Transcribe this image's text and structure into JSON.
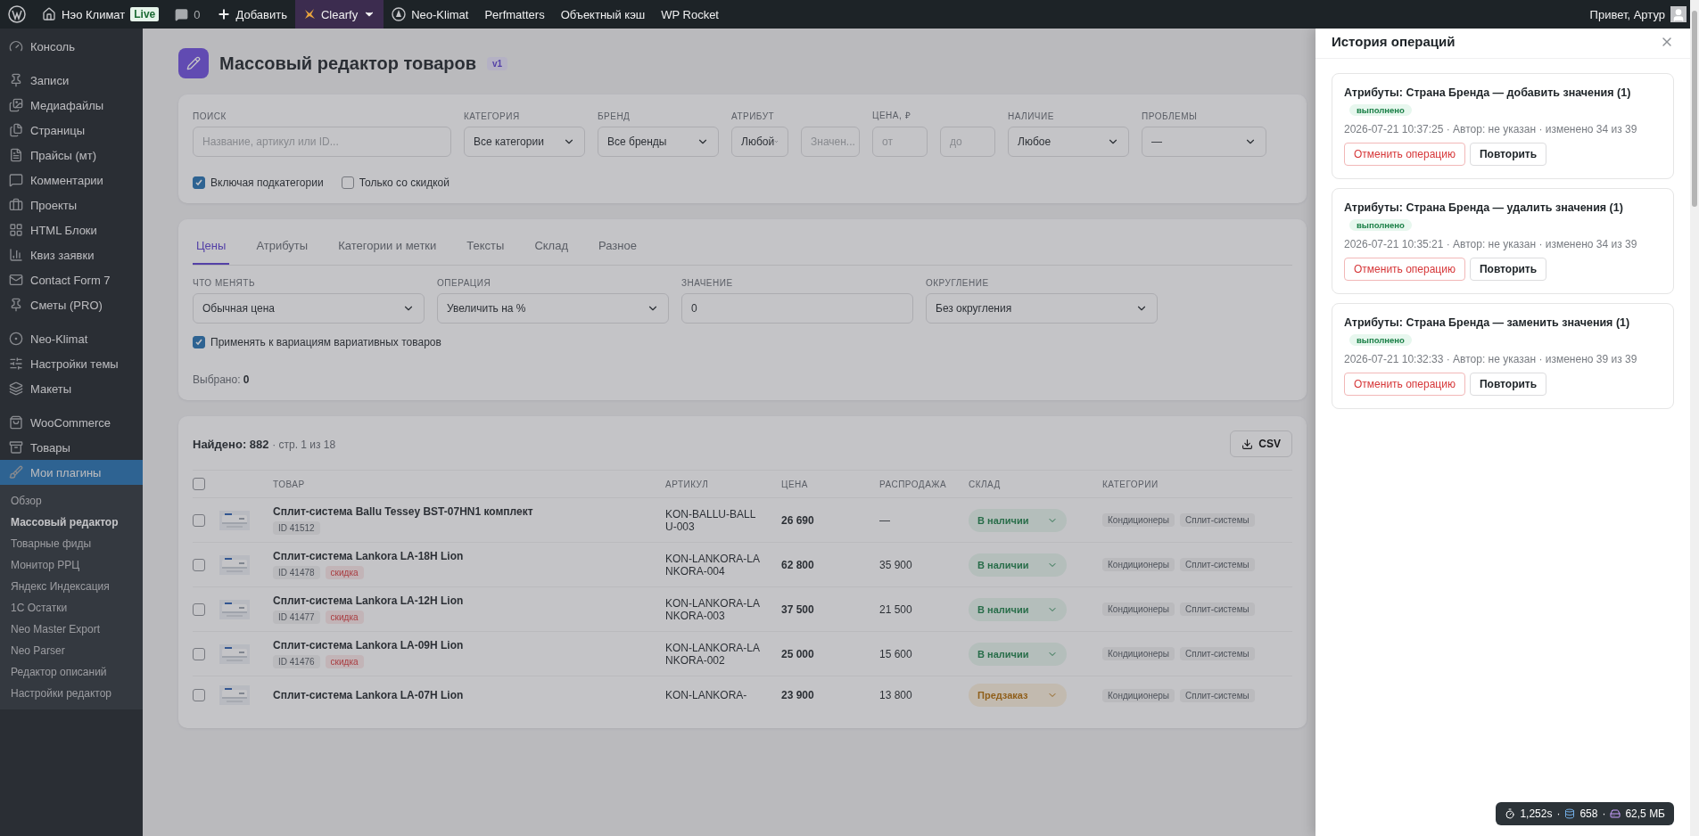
{
  "admin_bar": {
    "items": [
      {
        "kind": "logo",
        "highlighted": false
      },
      {
        "kind": "home",
        "label": "Нэо Климат",
        "badge": "Live",
        "highlighted": false
      },
      {
        "kind": "comments",
        "label": "0",
        "highlighted": false
      },
      {
        "kind": "add",
        "label": "Добавить",
        "highlighted": false
      },
      {
        "kind": "clearfy",
        "label": "Clearfy",
        "highlighted": true
      },
      {
        "kind": "neo",
        "label": "Neo-Klimat",
        "highlighted": false
      },
      {
        "kind": "text",
        "label": "Perfmatters",
        "highlighted": false
      },
      {
        "kind": "text",
        "label": "Объектный кэш",
        "highlighted": false
      },
      {
        "kind": "text",
        "label": "WP Rocket",
        "highlighted": false
      }
    ],
    "greeting": "Привет, Артур"
  },
  "sidebar": {
    "groups": [
      [
        {
          "label": "Консоль",
          "current": false
        }
      ],
      [
        {
          "label": "Записи",
          "current": false
        },
        {
          "label": "Медиафайлы",
          "current": false
        },
        {
          "label": "Страницы",
          "current": false
        },
        {
          "label": "Прайсы (мт)",
          "current": false
        },
        {
          "label": "Комментарии",
          "current": false
        },
        {
          "label": "Проекты",
          "current": false
        },
        {
          "label": "HTML Блоки",
          "current": false
        },
        {
          "label": "Квиз заявки",
          "current": false
        },
        {
          "label": "Contact Form 7",
          "current": false
        },
        {
          "label": "Сметы (PRO)",
          "current": false
        }
      ],
      [
        {
          "label": "Neo-Klimat",
          "current": false
        },
        {
          "label": "Настройки темы",
          "current": false
        },
        {
          "label": "Макеты",
          "current": false
        }
      ],
      [
        {
          "label": "WooCommerce",
          "current": false
        },
        {
          "label": "Товары",
          "current": false
        },
        {
          "label": "Мои плагины",
          "current": true
        }
      ]
    ],
    "submenu": [
      {
        "label": "Обзор",
        "selected": false
      },
      {
        "label": "Массовый редактор",
        "selected": true
      },
      {
        "label": "Товарные фиды",
        "selected": false
      },
      {
        "label": "Монитор РРЦ",
        "selected": false
      },
      {
        "label": "Яндекс Индексация",
        "selected": false
      },
      {
        "label": "1С Остатки",
        "selected": false
      },
      {
        "label": "Neo Master Export",
        "selected": false
      },
      {
        "label": "Neo Parser",
        "selected": false
      },
      {
        "label": "Редактор описаний",
        "selected": false
      },
      {
        "label": "Настройки редактор",
        "selected": false
      }
    ]
  },
  "page": {
    "title": "Массовый редактор товаров",
    "version": "v1",
    "filters": [
      {
        "kind": "input",
        "label": "ПОИСК",
        "placeholder": "Название, артикул или ID..."
      },
      {
        "kind": "select",
        "label": "КАТЕГОРИЯ",
        "value": "Все категории"
      },
      {
        "kind": "select",
        "label": "БРЕНД",
        "value": "Все бренды"
      },
      {
        "kind": "pair",
        "label": "АТРИБУТ",
        "first": "Любой",
        "second": "Значен..."
      },
      {
        "kind": "range",
        "label": "ЦЕНА, ₽",
        "from": "от",
        "to": "до"
      },
      {
        "kind": "select",
        "label": "НАЛИЧИЕ",
        "value": "Любое"
      },
      {
        "kind": "select",
        "label": "ПРОБЛЕМЫ",
        "value": "—"
      }
    ],
    "options": [
      {
        "label": "Включая подкатегории",
        "checked": true
      },
      {
        "label": "Только со скидкой",
        "checked": false
      }
    ],
    "tabs": [
      {
        "label": "Цены",
        "selected": true
      },
      {
        "label": "Атрибуты",
        "selected": false
      },
      {
        "label": "Категории и метки",
        "selected": false
      },
      {
        "label": "Тексты",
        "selected": false
      },
      {
        "label": "Склад",
        "selected": false
      },
      {
        "label": "Разное",
        "selected": false
      }
    ],
    "edit_fields": [
      {
        "kind": "select",
        "label": "ЧТО МЕНЯТЬ",
        "value": "Обычная цена"
      },
      {
        "kind": "select",
        "label": "ОПЕРАЦИЯ",
        "value": "Увеличить на %"
      },
      {
        "kind": "input",
        "label": "ЗНАЧЕНИЕ",
        "value": "0"
      },
      {
        "kind": "select",
        "label": "ОКРУГЛЕНИЕ",
        "value": "Без округления"
      }
    ],
    "variations": {
      "label": "Применять к вариациям вариативных товаров",
      "checked": true
    },
    "selected_label": "Выбрано:",
    "selected_count": "0",
    "found_label": "Найдено: 882",
    "pages": "· стр. 1 из 18",
    "export": "CSV",
    "table": {
      "select_all_checked": false,
      "columns": [
        "ТОВАР",
        "АРТИКУЛ",
        "ЦЕНА",
        "РАСПРОДАЖА",
        "СКЛАД",
        "КАТЕГОРИИ"
      ],
      "rows": [
        {
          "checked": false,
          "name": "Сплит-система Ballu Tessey BST-07HN1 комплект",
          "id": "ID 41512",
          "tag": "",
          "sku": "KON-BALLU-BALLU-003",
          "price": "26 690",
          "sale": "—",
          "stock": {
            "label": "В наличии",
            "kind": "in"
          },
          "categories": [
            "Кондиционеры",
            "Сплит-системы"
          ]
        },
        {
          "checked": false,
          "name": "Сплит-система Lankora LA-18H Lion",
          "id": "ID 41478",
          "tag": "скидка",
          "sku": "KON-LANKORA-LANKORA-004",
          "price": "62 800",
          "sale": "35 900",
          "stock": {
            "label": "В наличии",
            "kind": "in"
          },
          "categories": [
            "Кондиционеры",
            "Сплит-системы"
          ]
        },
        {
          "checked": false,
          "name": "Сплит-система Lankora LA-12H Lion",
          "id": "ID 41477",
          "tag": "скидка",
          "sku": "KON-LANKORA-LANKORA-003",
          "price": "37 500",
          "sale": "21 500",
          "stock": {
            "label": "В наличии",
            "kind": "in"
          },
          "categories": [
            "Кондиционеры",
            "Сплит-системы"
          ]
        },
        {
          "checked": false,
          "name": "Сплит-система Lankora LA-09H Lion",
          "id": "ID 41476",
          "tag": "скидка",
          "sku": "KON-LANKORA-LANKORA-002",
          "price": "25 000",
          "sale": "15 600",
          "stock": {
            "label": "В наличии",
            "kind": "in"
          },
          "categories": [
            "Кондиционеры",
            "Сплит-системы"
          ]
        },
        {
          "checked": false,
          "name": "Сплит-система Lankora LA-07H Lion",
          "id": "",
          "tag": "",
          "sku": "KON-LANKORA-",
          "price": "23 900",
          "sale": "13 800",
          "stock": {
            "label": "Предзаказ",
            "kind": "pre"
          },
          "categories": [
            "Кондиционеры",
            "Сплит-системы"
          ]
        }
      ]
    }
  },
  "history": {
    "title": "История операций",
    "operations": [
      {
        "title": "Атрибуты: Страна Бренда — добавить значения (1)",
        "status": "выполнено",
        "meta": "2026-07-21 10:37:25 · Автор: не указан · изменено 34 из 39",
        "undo": "Отменить операцию",
        "repeat": "Повторить"
      },
      {
        "title": "Атрибуты: Страна Бренда — удалить значения (1)",
        "status": "выполнено",
        "meta": "2026-07-21 10:35:21 · Автор: не указан · изменено 34 из 39",
        "undo": "Отменить операцию",
        "repeat": "Повторить"
      },
      {
        "title": "Атрибуты: Страна Бренда — заменить значения (1)",
        "status": "выполнено",
        "meta": "2026-07-21 10:32:33 · Автор: не указан · изменено 39 из 39",
        "undo": "Отменить операцию",
        "repeat": "Повторить"
      }
    ]
  },
  "perf_badge": {
    "time": "1,252s",
    "separator_1": "·",
    "queries": "658",
    "separator_2": "·",
    "memory": "62,5 МБ"
  }
}
